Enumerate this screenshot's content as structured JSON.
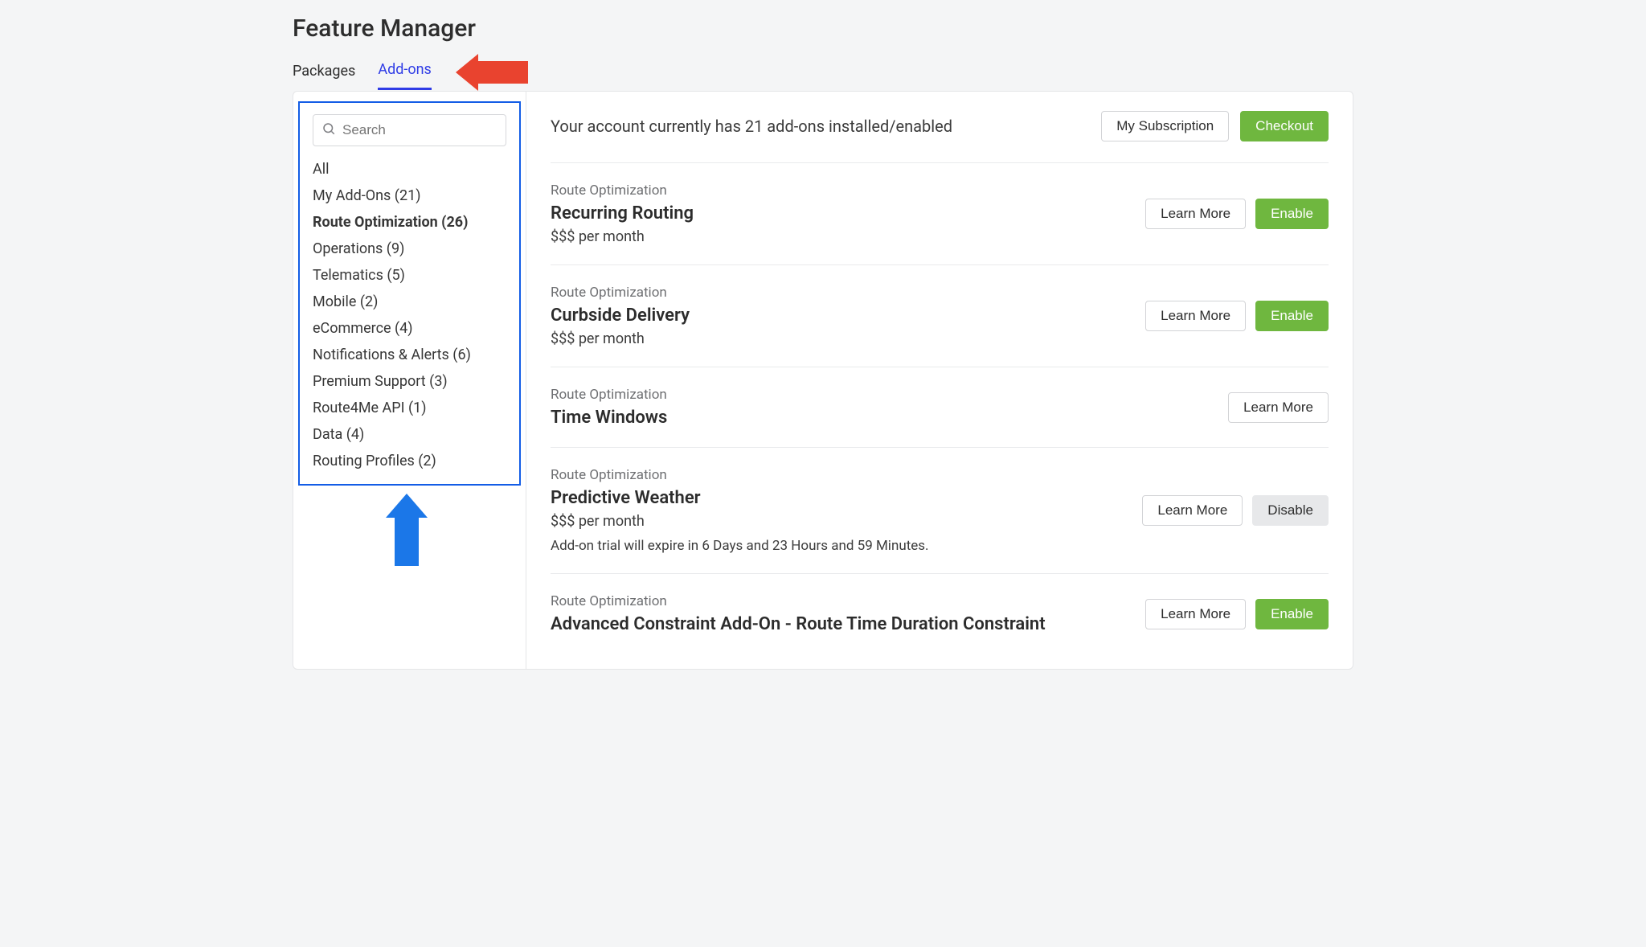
{
  "page_title": "Feature Manager",
  "tabs": {
    "packages": "Packages",
    "addons": "Add-ons"
  },
  "sidebar": {
    "search_placeholder": "Search",
    "categories": [
      {
        "label": "All"
      },
      {
        "label": "My Add-Ons (21)"
      },
      {
        "label": "Route Optimization (26)",
        "active": true
      },
      {
        "label": "Operations (9)"
      },
      {
        "label": "Telematics (5)"
      },
      {
        "label": "Mobile (2)"
      },
      {
        "label": "eCommerce (4)"
      },
      {
        "label": "Notifications & Alerts (6)"
      },
      {
        "label": "Premium Support (3)"
      },
      {
        "label": "Route4Me API (1)"
      },
      {
        "label": "Data (4)"
      },
      {
        "label": "Routing Profiles (2)"
      }
    ]
  },
  "topbar": {
    "text": "Your account currently has 21 add-ons installed/enabled",
    "my_subscription": "My Subscription",
    "checkout": "Checkout"
  },
  "buttons": {
    "learn_more": "Learn More",
    "enable": "Enable",
    "disable": "Disable"
  },
  "addons": [
    {
      "category": "Route Optimization",
      "title": "Recurring Routing",
      "price": "$$$ per month",
      "learn_more": true,
      "action": "enable"
    },
    {
      "category": "Route Optimization",
      "title": "Curbside Delivery",
      "price": "$$$ per month",
      "learn_more": true,
      "action": "enable"
    },
    {
      "category": "Route Optimization",
      "title": "Time Windows",
      "learn_more": true
    },
    {
      "category": "Route Optimization",
      "title": "Predictive Weather",
      "price": "$$$ per month",
      "note": "Add-on trial will expire in 6 Days and 23 Hours and 59 Minutes.",
      "learn_more": true,
      "action": "disable"
    },
    {
      "category": "Route Optimization",
      "title": "Advanced Constraint Add-On - Route Time Duration Constraint",
      "learn_more": true,
      "action": "enable"
    }
  ]
}
